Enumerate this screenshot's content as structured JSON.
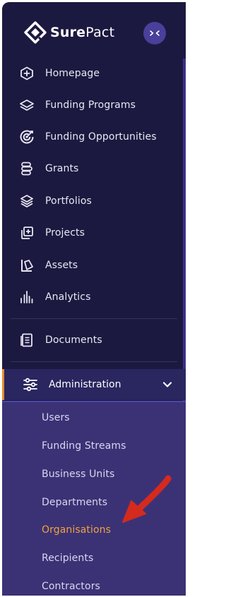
{
  "brand": {
    "name_bold": "Sure",
    "name_light": "Pact",
    "accent_color": "#e98b2a"
  },
  "collapse": {
    "label": "><"
  },
  "nav": [
    {
      "label": "Homepage",
      "icon": "plus-circle-icon"
    },
    {
      "label": "Funding Programs",
      "icon": "layers-icon"
    },
    {
      "label": "Funding Opportunities",
      "icon": "target-icon"
    },
    {
      "label": "Grants",
      "icon": "database-icon"
    },
    {
      "label": "Portfolios",
      "icon": "stack-icon"
    },
    {
      "label": "Projects",
      "icon": "copy-plus-icon"
    },
    {
      "label": "Assets",
      "icon": "shapes-icon"
    },
    {
      "label": "Analytics",
      "icon": "bar-chart-icon"
    }
  ],
  "documents": {
    "label": "Documents",
    "icon": "document-icon"
  },
  "administration": {
    "label": "Administration",
    "icon": "sliders-icon",
    "expanded": true,
    "items": [
      {
        "label": "Users",
        "active": false
      },
      {
        "label": "Funding Streams",
        "active": false
      },
      {
        "label": "Business Units",
        "active": false
      },
      {
        "label": "Departments",
        "active": false
      },
      {
        "label": "Organisations",
        "active": true
      },
      {
        "label": "Recipients",
        "active": false
      },
      {
        "label": "Contractors",
        "active": false
      }
    ]
  }
}
